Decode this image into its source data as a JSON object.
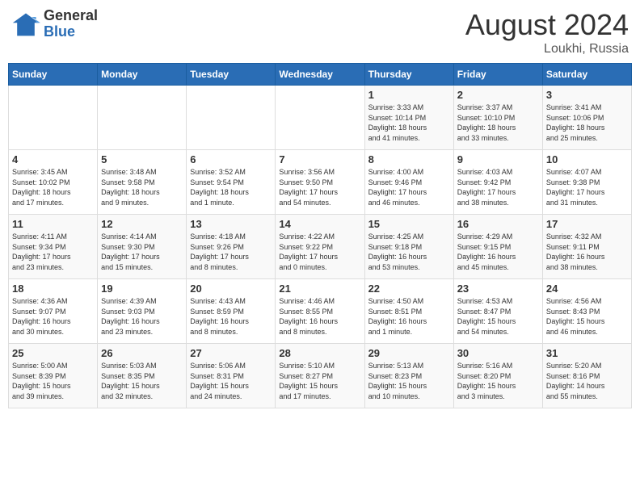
{
  "header": {
    "logo_general": "General",
    "logo_blue": "Blue",
    "month_title": "August 2024",
    "location": "Loukhi, Russia"
  },
  "days_of_week": [
    "Sunday",
    "Monday",
    "Tuesday",
    "Wednesday",
    "Thursday",
    "Friday",
    "Saturday"
  ],
  "weeks": [
    [
      {
        "day": "",
        "info": ""
      },
      {
        "day": "",
        "info": ""
      },
      {
        "day": "",
        "info": ""
      },
      {
        "day": "",
        "info": ""
      },
      {
        "day": "1",
        "info": "Sunrise: 3:33 AM\nSunset: 10:14 PM\nDaylight: 18 hours\nand 41 minutes."
      },
      {
        "day": "2",
        "info": "Sunrise: 3:37 AM\nSunset: 10:10 PM\nDaylight: 18 hours\nand 33 minutes."
      },
      {
        "day": "3",
        "info": "Sunrise: 3:41 AM\nSunset: 10:06 PM\nDaylight: 18 hours\nand 25 minutes."
      }
    ],
    [
      {
        "day": "4",
        "info": "Sunrise: 3:45 AM\nSunset: 10:02 PM\nDaylight: 18 hours\nand 17 minutes."
      },
      {
        "day": "5",
        "info": "Sunrise: 3:48 AM\nSunset: 9:58 PM\nDaylight: 18 hours\nand 9 minutes."
      },
      {
        "day": "6",
        "info": "Sunrise: 3:52 AM\nSunset: 9:54 PM\nDaylight: 18 hours\nand 1 minute."
      },
      {
        "day": "7",
        "info": "Sunrise: 3:56 AM\nSunset: 9:50 PM\nDaylight: 17 hours\nand 54 minutes."
      },
      {
        "day": "8",
        "info": "Sunrise: 4:00 AM\nSunset: 9:46 PM\nDaylight: 17 hours\nand 46 minutes."
      },
      {
        "day": "9",
        "info": "Sunrise: 4:03 AM\nSunset: 9:42 PM\nDaylight: 17 hours\nand 38 minutes."
      },
      {
        "day": "10",
        "info": "Sunrise: 4:07 AM\nSunset: 9:38 PM\nDaylight: 17 hours\nand 31 minutes."
      }
    ],
    [
      {
        "day": "11",
        "info": "Sunrise: 4:11 AM\nSunset: 9:34 PM\nDaylight: 17 hours\nand 23 minutes."
      },
      {
        "day": "12",
        "info": "Sunrise: 4:14 AM\nSunset: 9:30 PM\nDaylight: 17 hours\nand 15 minutes."
      },
      {
        "day": "13",
        "info": "Sunrise: 4:18 AM\nSunset: 9:26 PM\nDaylight: 17 hours\nand 8 minutes."
      },
      {
        "day": "14",
        "info": "Sunrise: 4:22 AM\nSunset: 9:22 PM\nDaylight: 17 hours\nand 0 minutes."
      },
      {
        "day": "15",
        "info": "Sunrise: 4:25 AM\nSunset: 9:18 PM\nDaylight: 16 hours\nand 53 minutes."
      },
      {
        "day": "16",
        "info": "Sunrise: 4:29 AM\nSunset: 9:15 PM\nDaylight: 16 hours\nand 45 minutes."
      },
      {
        "day": "17",
        "info": "Sunrise: 4:32 AM\nSunset: 9:11 PM\nDaylight: 16 hours\nand 38 minutes."
      }
    ],
    [
      {
        "day": "18",
        "info": "Sunrise: 4:36 AM\nSunset: 9:07 PM\nDaylight: 16 hours\nand 30 minutes."
      },
      {
        "day": "19",
        "info": "Sunrise: 4:39 AM\nSunset: 9:03 PM\nDaylight: 16 hours\nand 23 minutes."
      },
      {
        "day": "20",
        "info": "Sunrise: 4:43 AM\nSunset: 8:59 PM\nDaylight: 16 hours\nand 8 minutes."
      },
      {
        "day": "21",
        "info": "Sunrise: 4:46 AM\nSunset: 8:55 PM\nDaylight: 16 hours\nand 8 minutes."
      },
      {
        "day": "22",
        "info": "Sunrise: 4:50 AM\nSunset: 8:51 PM\nDaylight: 16 hours\nand 1 minute."
      },
      {
        "day": "23",
        "info": "Sunrise: 4:53 AM\nSunset: 8:47 PM\nDaylight: 15 hours\nand 54 minutes."
      },
      {
        "day": "24",
        "info": "Sunrise: 4:56 AM\nSunset: 8:43 PM\nDaylight: 15 hours\nand 46 minutes."
      }
    ],
    [
      {
        "day": "25",
        "info": "Sunrise: 5:00 AM\nSunset: 8:39 PM\nDaylight: 15 hours\nand 39 minutes."
      },
      {
        "day": "26",
        "info": "Sunrise: 5:03 AM\nSunset: 8:35 PM\nDaylight: 15 hours\nand 32 minutes."
      },
      {
        "day": "27",
        "info": "Sunrise: 5:06 AM\nSunset: 8:31 PM\nDaylight: 15 hours\nand 24 minutes."
      },
      {
        "day": "28",
        "info": "Sunrise: 5:10 AM\nSunset: 8:27 PM\nDaylight: 15 hours\nand 17 minutes."
      },
      {
        "day": "29",
        "info": "Sunrise: 5:13 AM\nSunset: 8:23 PM\nDaylight: 15 hours\nand 10 minutes."
      },
      {
        "day": "30",
        "info": "Sunrise: 5:16 AM\nSunset: 8:20 PM\nDaylight: 15 hours\nand 3 minutes."
      },
      {
        "day": "31",
        "info": "Sunrise: 5:20 AM\nSunset: 8:16 PM\nDaylight: 14 hours\nand 55 minutes."
      }
    ]
  ]
}
